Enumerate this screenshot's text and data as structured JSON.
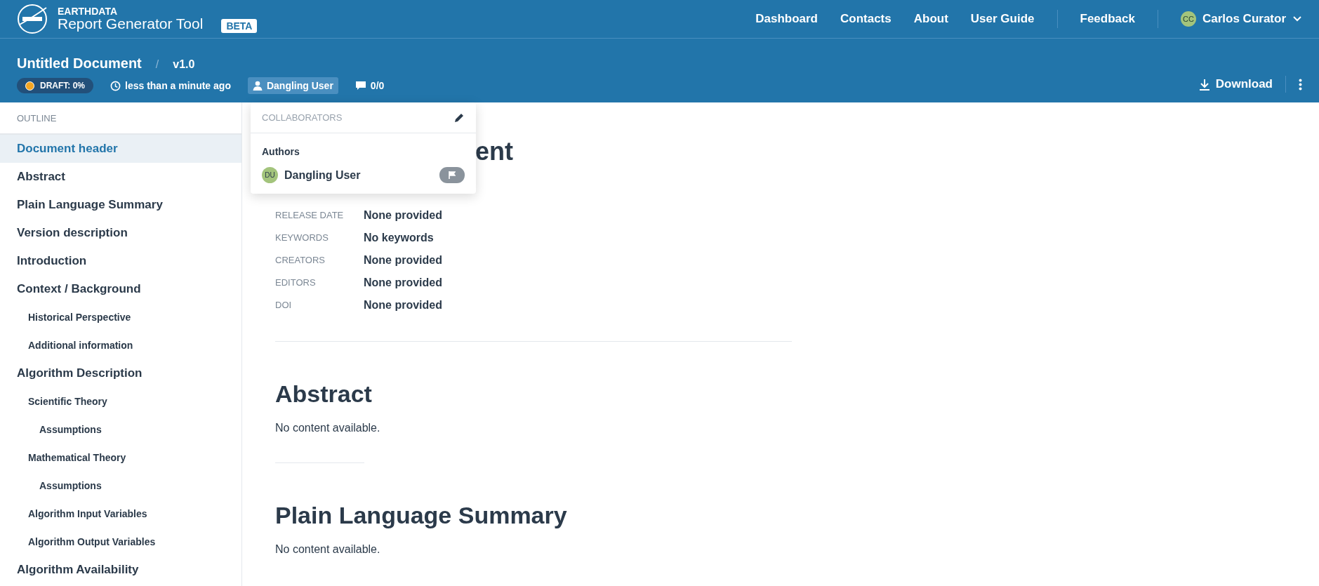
{
  "brand": {
    "org": "EARTHDATA",
    "app": "Report Generator Tool",
    "badge": "BETA"
  },
  "nav": [
    "Dashboard",
    "Contacts",
    "About",
    "User Guide",
    "Feedback"
  ],
  "user": {
    "initials": "CC",
    "name": "Carlos Curator"
  },
  "document": {
    "title": "Untitled Document",
    "separator": "/",
    "version": "v1.0",
    "status": "DRAFT: 0%",
    "updated": "less than a minute ago",
    "user": "Dangling User",
    "comments": "0/0",
    "download": "Download"
  },
  "outline": {
    "title": "OUTLINE",
    "items": [
      {
        "label": "Document header",
        "selected": true
      },
      {
        "label": "Abstract",
        "selected": false
      },
      {
        "label": "Plain Language Summary",
        "selected": false
      },
      {
        "label": "Version description",
        "selected": false
      },
      {
        "label": "Introduction",
        "selected": false
      },
      {
        "label": "Context / Background",
        "selected": false,
        "children": [
          {
            "label": "Historical Perspective",
            "selected": false
          },
          {
            "label": "Additional information",
            "selected": false
          }
        ]
      },
      {
        "label": "Algorithm Description",
        "selected": false,
        "children": [
          {
            "label": "Scientific Theory",
            "selected": false,
            "children": [
              {
                "label": "Assumptions",
                "selected": false
              }
            ]
          },
          {
            "label": "Mathematical Theory",
            "selected": false,
            "children": [
              {
                "label": "Assumptions",
                "selected": false
              }
            ]
          },
          {
            "label": "Algorithm Input Variables",
            "selected": false
          },
          {
            "label": "Algorithm Output Variables",
            "selected": false
          }
        ]
      },
      {
        "label": "Algorithm Availability",
        "selected": false
      }
    ]
  },
  "content": {
    "heading": "ent",
    "fields": [
      {
        "label": "RELEASE DATE",
        "value": "None provided"
      },
      {
        "label": "KEYWORDS",
        "value": "No keywords"
      },
      {
        "label": "CREATORS",
        "value": "None provided"
      },
      {
        "label": "EDITORS",
        "value": "None provided"
      },
      {
        "label": "DOI",
        "value": "None provided"
      }
    ],
    "sections": [
      {
        "title": "Abstract",
        "text": "No content available."
      },
      {
        "title": "Plain Language Summary",
        "text": "No content available."
      }
    ]
  },
  "collaborators": {
    "title": "COLLABORATORS",
    "group": "Authors",
    "people": [
      {
        "initials": "DU",
        "name": "Dangling User"
      }
    ]
  }
}
